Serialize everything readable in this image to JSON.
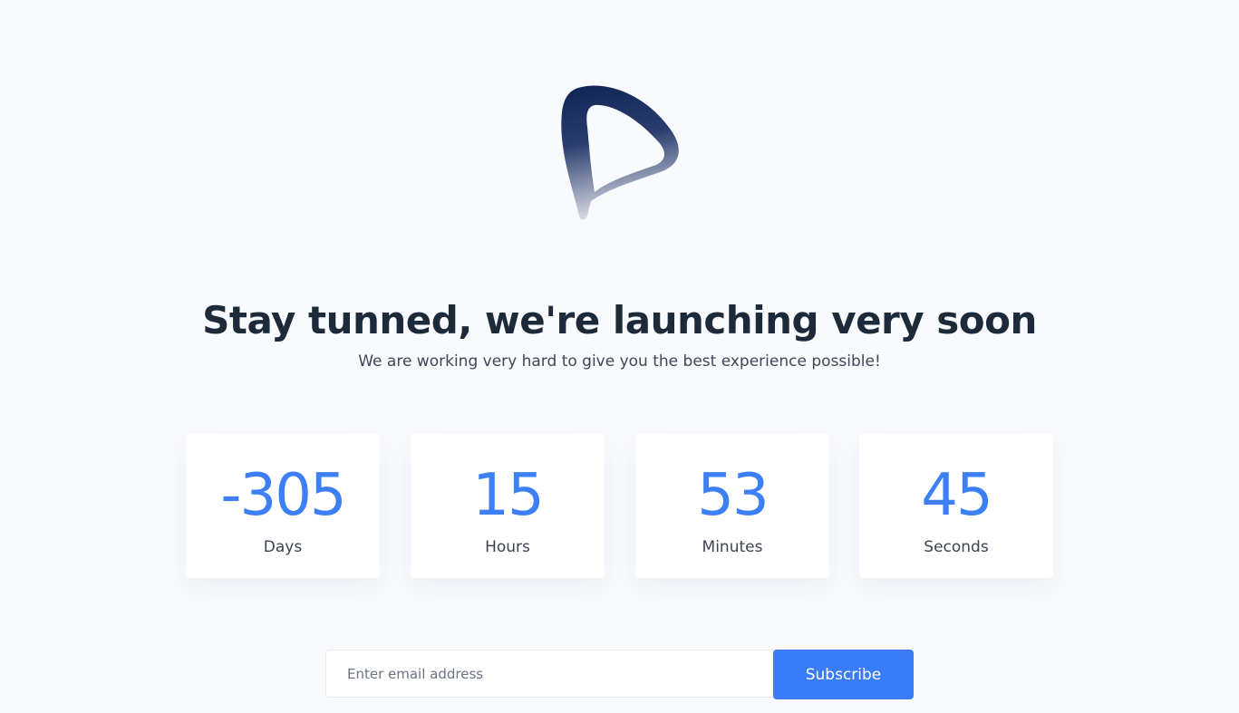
{
  "brand": {
    "logo_icon": "p-logo-icon",
    "colors": {
      "logo_dark": "#0f2454",
      "logo_light": "#c4c9d6"
    }
  },
  "hero": {
    "title": "Stay tunned, we're launching very soon",
    "subtitle": "We are working very hard to give you the best experience possible!"
  },
  "countdown": [
    {
      "value": "-305",
      "label": "Days"
    },
    {
      "value": "15",
      "label": "Hours"
    },
    {
      "value": "53",
      "label": "Minutes"
    },
    {
      "value": "45",
      "label": "Seconds"
    }
  ],
  "subscribe": {
    "placeholder": "Enter email address",
    "value": "",
    "button_label": "Subscribe"
  },
  "colors": {
    "accent": "#3a7cf7",
    "heading": "#1d2a3a",
    "background": "#f8fafd"
  }
}
